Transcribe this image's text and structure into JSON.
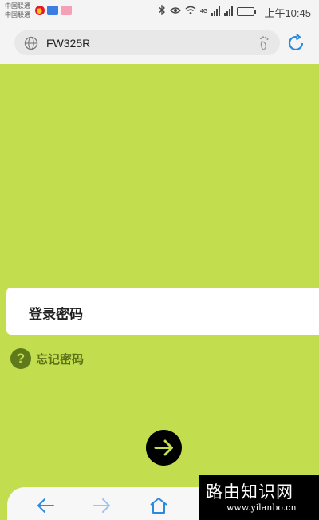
{
  "status_bar": {
    "carrier_1": "中国联通",
    "carrier_2": "中国联通",
    "network_label": "4G",
    "clock": "上午10:45"
  },
  "browser": {
    "url": "FW325R"
  },
  "login": {
    "password_placeholder": "登录密码",
    "forgot_password": "忘记密码"
  },
  "watermark": {
    "title": "路由知识网",
    "url": "www.yilanbo.cn"
  },
  "colors": {
    "page_background": "#c2de4f",
    "accent_blue": "#2a8ae0",
    "help_green": "#5f7a1a"
  },
  "icons": {
    "globe": "globe-icon",
    "privacy": "footprint-icon",
    "refresh": "refresh-icon",
    "help": "help-icon",
    "submit": "arrow-right-icon",
    "back": "back-arrow-icon",
    "forward": "forward-arrow-icon",
    "home": "home-icon"
  }
}
